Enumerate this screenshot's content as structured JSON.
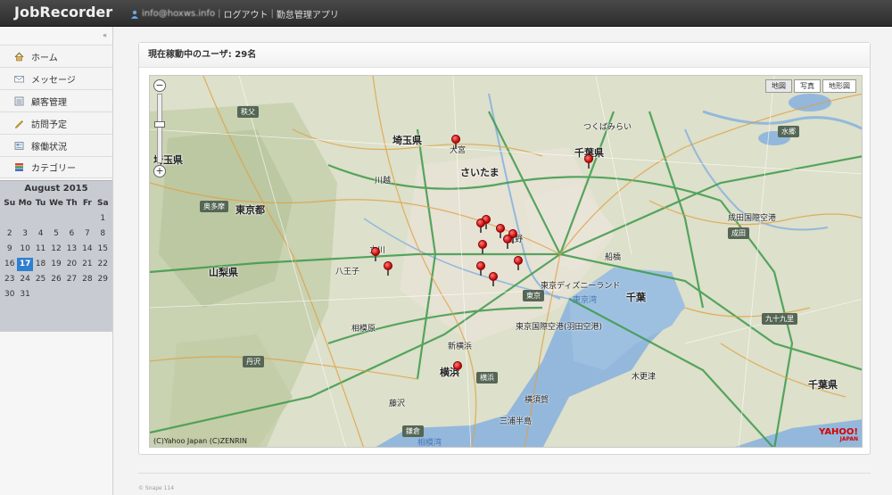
{
  "header": {
    "brand": "JobRecorder",
    "user_email": "info@hoxws.info",
    "separator": "|",
    "logout": "ログアウト",
    "app_link": "勤怠管理アプリ"
  },
  "sidebar": {
    "collapse_glyph": "«",
    "items": [
      {
        "label": "ホーム",
        "icon": "home-icon"
      },
      {
        "label": "メッセージ",
        "icon": "mail-icon"
      },
      {
        "label": "顧客管理",
        "icon": "list-icon"
      },
      {
        "label": "訪問予定",
        "icon": "pencil-icon"
      },
      {
        "label": "稼働状況",
        "icon": "status-icon"
      },
      {
        "label": "カテゴリー",
        "icon": "category-icon"
      }
    ]
  },
  "calendar": {
    "title": "August 2015",
    "days_of_week": [
      "Su",
      "Mo",
      "Tu",
      "We",
      "Th",
      "Fr",
      "Sa"
    ],
    "weeks": [
      [
        "",
        "",
        "",
        "",
        "",
        "",
        "1"
      ],
      [
        "2",
        "3",
        "4",
        "5",
        "6",
        "7",
        "8"
      ],
      [
        "9",
        "10",
        "11",
        "12",
        "13",
        "14",
        "15"
      ],
      [
        "16",
        "17",
        "18",
        "19",
        "20",
        "21",
        "22"
      ],
      [
        "23",
        "24",
        "25",
        "26",
        "27",
        "28",
        "29"
      ],
      [
        "30",
        "31",
        "",
        "",
        "",
        "",
        ""
      ]
    ],
    "today": "17"
  },
  "panel": {
    "title": "現在稼動中のユーザ: 29名"
  },
  "map": {
    "buttons": [
      "地図",
      "写真",
      "地形図"
    ],
    "active_button": "地図",
    "zoom_in": "+",
    "zoom_out": "−",
    "copyright": "(C)Yahoo Japan (C)ZENRIN",
    "logo_main": "YAHOO!",
    "logo_sub": "JAPAN",
    "labels": {
      "chichibu": "秩父",
      "saitama_pref": "埼玉県",
      "saitama_pref_left": "埼玉県",
      "saitama_city": "さいたま",
      "okutama": "奥多摩",
      "tokyo_to": "東京都",
      "tokyo": "東京",
      "yamanashi": "山梨県",
      "tanzawa": "丹沢",
      "yokohama": "横浜",
      "yokohama_city": "横浜",
      "kamakura": "鎌倉",
      "chiba_pref": "千葉県",
      "chiba_pref_south": "千葉県",
      "chiba": "千葉",
      "narita": "成田",
      "mito": "水郷",
      "kujukuri": "九十九里",
      "tokyo_bay": "東京湾",
      "haneda": "東京国際空港(羽田空港)",
      "narita_airport": "成田国際空港",
      "disney": "東京ディズニーランド",
      "omiya": "大宮",
      "ueno": "上野",
      "shin_yokohama": "新横浜",
      "kisarazu": "木更津",
      "tsukuba": "つくばみらい",
      "hachioji": "八王子",
      "sagamihara": "相模原",
      "tachikawa": "立川",
      "kawagoe": "川越",
      "funabashi": "船橋",
      "fujisawa": "藤沢",
      "sagami_bay": "相模湾",
      "miura": "三浦半島",
      "yokosuka": "横須賀"
    }
  },
  "footer": {
    "text": "© Snape 114"
  },
  "colors": {
    "topbar": "#333333",
    "accent": "#2f7fd0",
    "pin": "#c40000",
    "sea": "#8fb4da",
    "land": "#d9dcc9"
  }
}
